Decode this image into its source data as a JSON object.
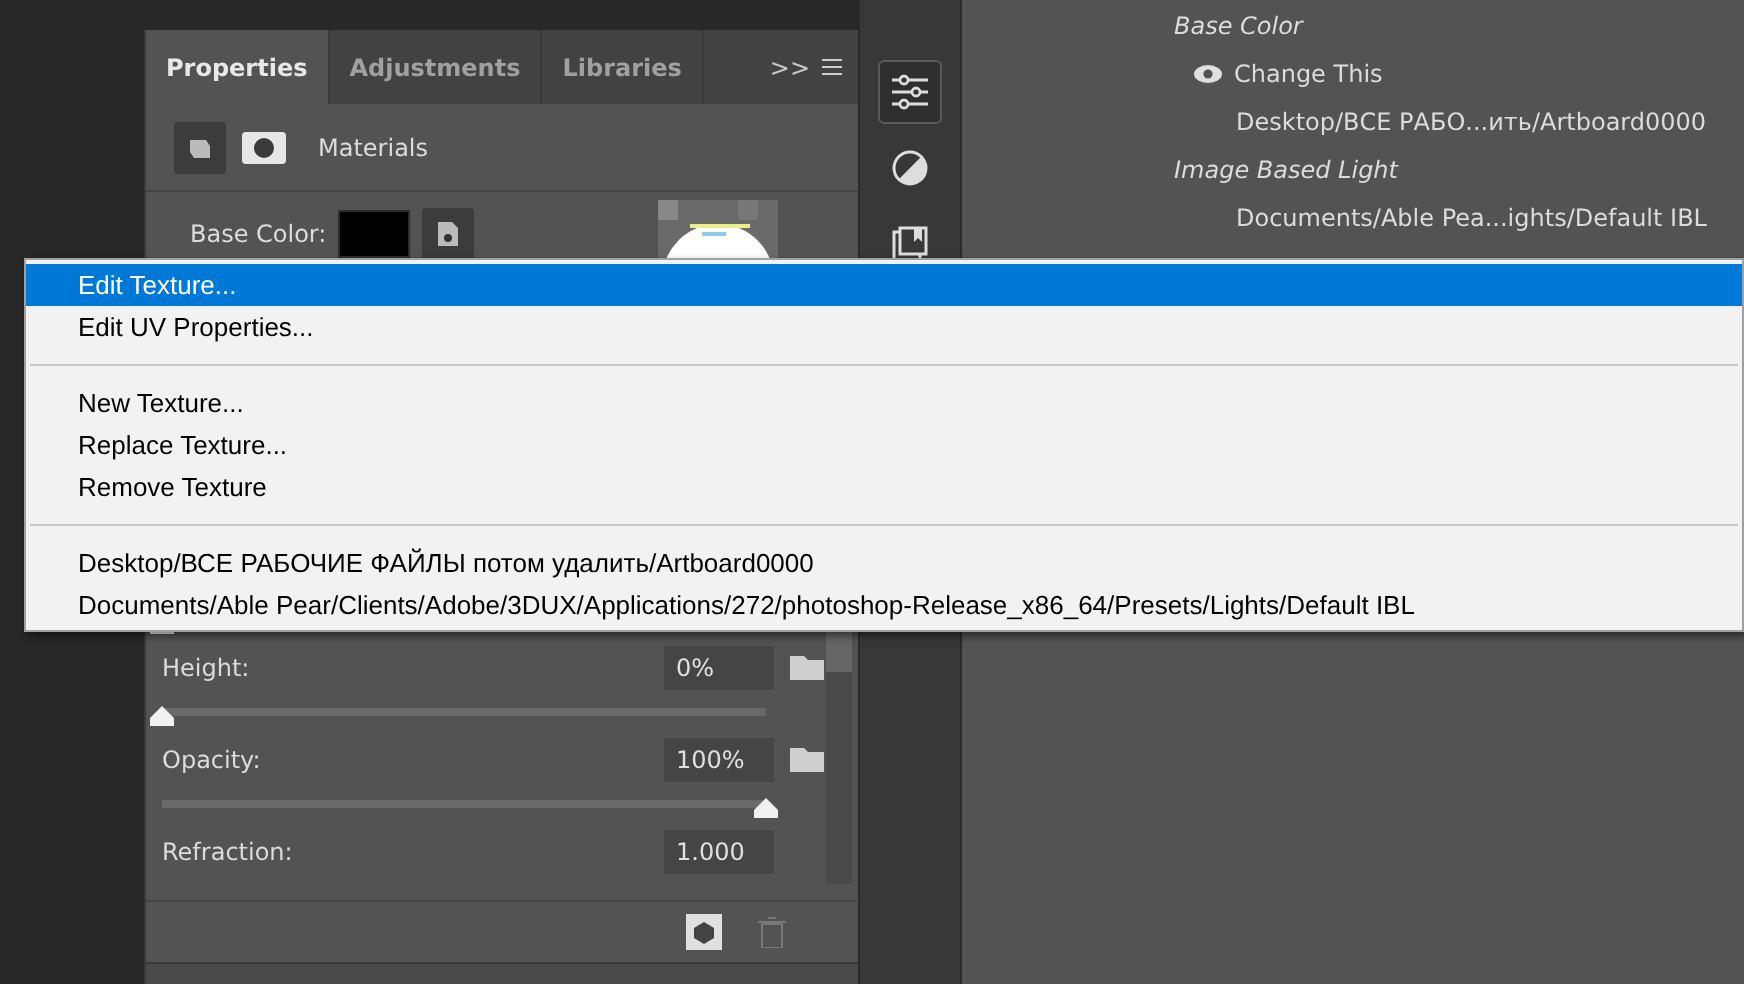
{
  "panel": {
    "tabs": [
      {
        "label": "Properties",
        "selected": true
      },
      {
        "label": "Adjustments",
        "selected": false
      },
      {
        "label": "Libraries",
        "selected": false
      }
    ],
    "overflow": ">>",
    "section_title": "Materials",
    "base_color": {
      "label": "Base Color:"
    },
    "sliders": [
      {
        "level": 0
      },
      {
        "label": "Height:",
        "value": "0%",
        "level": 0
      },
      {
        "label": "Opacity:",
        "value": "100%",
        "level": 1
      }
    ],
    "refraction": {
      "label": "Refraction:",
      "value": "1.000"
    }
  },
  "tools": [
    {
      "selected": true
    },
    {
      "selected": false
    },
    {
      "selected": false
    }
  ],
  "layers": [
    {
      "kind": "heading",
      "text": "Base Color"
    },
    {
      "kind": "visible",
      "text": "Change This"
    },
    {
      "kind": "path",
      "text": "Desktop/ВСЕ РАБО...ить/Artboard0000"
    },
    {
      "kind": "heading",
      "text": "Image Based Light"
    },
    {
      "kind": "path",
      "text": "Documents/Able Pea...ights/Default IBL"
    }
  ],
  "menu": [
    [
      {
        "label": "Edit Texture...",
        "selected": true
      },
      {
        "label": "Edit UV Properties...",
        "selected": false
      }
    ],
    [
      {
        "label": "New Texture...",
        "selected": false
      },
      {
        "label": "Replace Texture...",
        "selected": false
      },
      {
        "label": "Remove Texture",
        "selected": false
      }
    ],
    [
      {
        "label": "Desktop/ВСЕ РАБОЧИЕ ФАЙЛЫ потом удалить/Artboard0000",
        "selected": false
      },
      {
        "label": "Documents/Able Pear/Clients/Adobe/3DUX/Applications/272/photoshop-Release_x86_64/Presets/Lights/Default IBL",
        "selected": false
      }
    ]
  ]
}
